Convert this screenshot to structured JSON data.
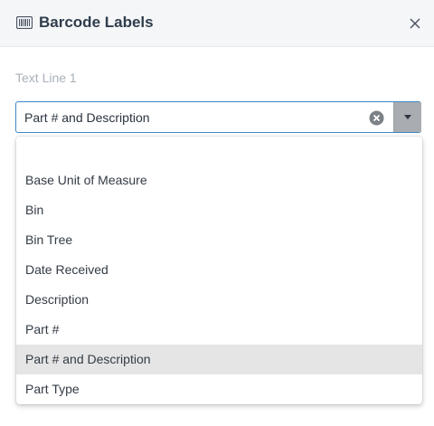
{
  "dialog": {
    "title": "Barcode Labels",
    "header_icon": "barcode-icon",
    "close_icon": "close-icon"
  },
  "field": {
    "label": "Text Line 1",
    "value": "Part # and Description",
    "clear_icon": "clear-circle-icon",
    "toggle_icon": "caret-down-icon"
  },
  "dropdown": {
    "options": [
      "",
      "Base Unit of Measure",
      "Bin",
      "Bin Tree",
      "Date Received",
      "Description",
      "Part #",
      "Part # and Description",
      "Part Type"
    ],
    "selected": "Part # and Description"
  },
  "colors": {
    "accent_border": "#3f88c5",
    "header_bg": "#f5f6f7",
    "selected_bg": "#e5e5e5"
  }
}
